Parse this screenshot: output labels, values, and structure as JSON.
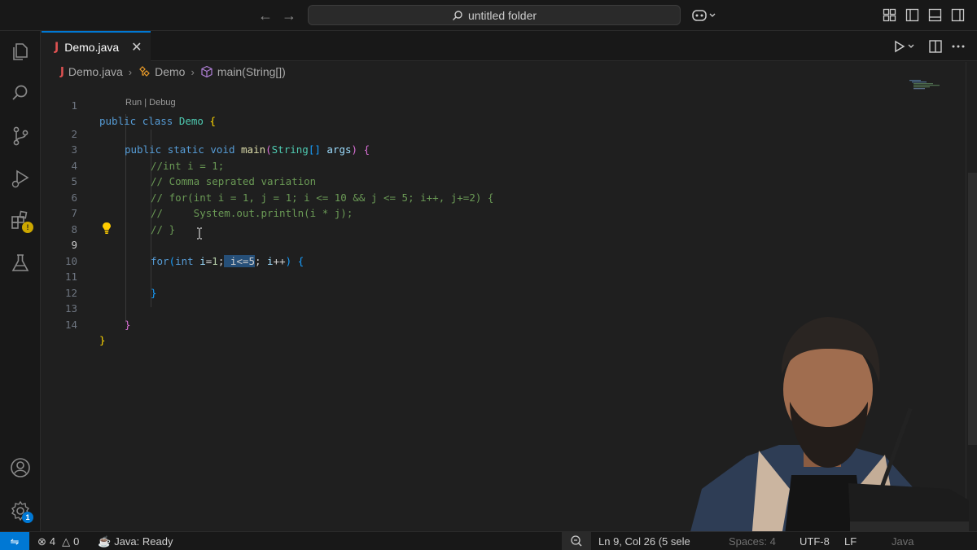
{
  "titlebar": {
    "search_label": "untitled folder",
    "back_icon": "arrow-left-icon",
    "forward_icon": "arrow-right-icon"
  },
  "tab": {
    "icon_letter": "J",
    "label": "Demo.java"
  },
  "breadcrumb": {
    "file": "Demo.java",
    "class": "Demo",
    "method": "main(String[])"
  },
  "codelens": "Run | Debug",
  "code": {
    "lines": [
      {
        "num": "1"
      },
      {
        "num": "2"
      },
      {
        "num": "3",
        "text": "//int i = 1;"
      },
      {
        "num": "4",
        "text": "// Comma seprated variation"
      },
      {
        "num": "5",
        "text": "// for(int i = 1, j = 1; i <= 10 && j <= 5; i++, j+=2) {"
      },
      {
        "num": "6",
        "text": "//     System.out.println(i * j);"
      },
      {
        "num": "7",
        "text": "// }"
      },
      {
        "num": "8"
      },
      {
        "num": "9"
      },
      {
        "num": "10"
      },
      {
        "num": "11"
      },
      {
        "num": "12"
      },
      {
        "num": "13"
      },
      {
        "num": "14"
      }
    ],
    "active_line": "9",
    "selection": "i<=5"
  },
  "statusbar": {
    "errors": "4",
    "warnings": "0",
    "java_status": "Java: Ready",
    "cursor_position": "Ln 9, Col 26 (5 sele",
    "spaces": "Spaces: 4",
    "encoding": "UTF-8",
    "eol": "LF",
    "language": "Java"
  },
  "activitybar": {
    "extensions_badge": "!",
    "settings_badge": "1"
  },
  "colors": {
    "accent": "#0078d4",
    "background": "#1f1f1f",
    "sidebar": "#181818"
  }
}
